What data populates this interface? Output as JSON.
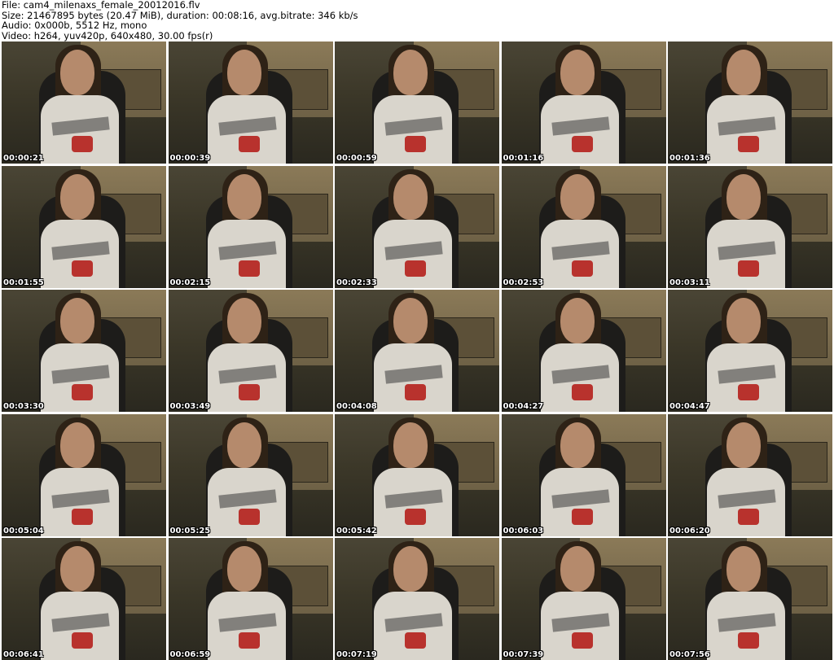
{
  "header": {
    "file": "File: cam4_milenaxs_female_20012016.flv",
    "size": "Size: 21467895 bytes (20.47 MiB), duration: 00:08:16, avg.bitrate: 346 kb/s",
    "audio": "Audio: 0x000b, 5512 Hz, mono",
    "video": "Video: h264, yuv420p, 640x480, 30.00 fps(r)"
  },
  "thumbnails": [
    "00:00:21",
    "00:00:39",
    "00:00:59",
    "00:01:16",
    "00:01:36",
    "00:01:55",
    "00:02:15",
    "00:02:33",
    "00:02:53",
    "00:03:11",
    "00:03:30",
    "00:03:49",
    "00:04:08",
    "00:04:27",
    "00:04:47",
    "00:05:04",
    "00:05:25",
    "00:05:42",
    "00:06:03",
    "00:06:20",
    "00:06:41",
    "00:06:59",
    "00:07:19",
    "00:07:39",
    "00:07:56"
  ]
}
